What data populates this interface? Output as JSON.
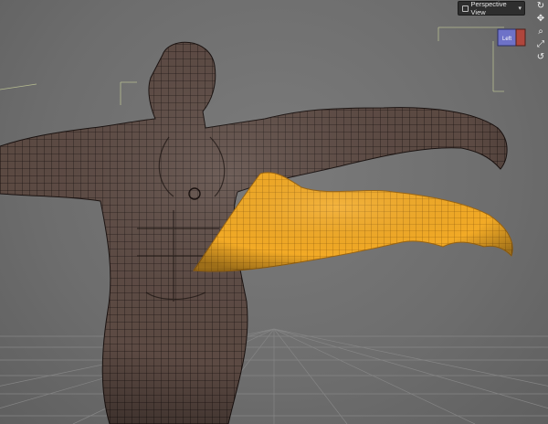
{
  "viewport": {
    "view_label": "Perspective View",
    "view_icon": "camera-icon",
    "dropdown_icon": "chevron-down-icon",
    "navcube_face_label": "Left"
  },
  "nav_tools": [
    {
      "name": "rotate-icon",
      "glyph": "↻"
    },
    {
      "name": "pan-icon",
      "glyph": "✥"
    },
    {
      "name": "zoom-icon",
      "glyph": "⌕"
    },
    {
      "name": "frame-icon",
      "glyph": "⤢"
    },
    {
      "name": "orbit-icon",
      "glyph": "↺"
    }
  ],
  "colors": {
    "background": "#6f6f6f",
    "figure_skin": "#5b4a42",
    "wireframe": "#1c1412",
    "selection": "#f2aa26",
    "toolbar": "#2e2e2e",
    "text": "#e4e4e4"
  }
}
